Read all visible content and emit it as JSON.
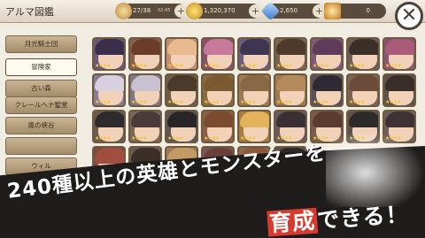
{
  "header": {
    "title": "アルマ図鑑",
    "stamina": "27/38",
    "stamina_timer": "02:45",
    "gold": "1,320,370",
    "gems": "2,650",
    "crowns": "0"
  },
  "sidebar": {
    "tabs": [
      {
        "label": "月光騎士団"
      },
      {
        "label": "冒険家"
      },
      {
        "label": "古い森"
      },
      {
        "label": "クレールヘナ聖堂"
      },
      {
        "label": "風の峡谷"
      },
      {
        "label": ""
      },
      {
        "label": "ウィル"
      },
      {
        "label": ""
      }
    ]
  },
  "grid": {
    "cards": [
      {
        "hair": "#3a2e4d",
        "bg": "#6b5776"
      },
      {
        "hair": "#6b3c2a",
        "bg": "#86624b"
      },
      {
        "hair": "#e9b98e",
        "bg": "#c58e6e"
      },
      {
        "hair": "#c7799c",
        "bg": "#8a4f6b"
      },
      {
        "hair": "#3d3552",
        "bg": "#6a5e7d"
      },
      {
        "hair": "#4d3a2c",
        "bg": "#7c6350"
      },
      {
        "hair": "#5e3b59",
        "bg": "#7f5b7a"
      },
      {
        "hair": "#3b2f2a",
        "bg": "#6e5f52"
      },
      {
        "hair": "#a85c7a",
        "bg": "#8c5570"
      },
      {
        "hair": "#d8d0e0",
        "bg": "#8a7c94"
      },
      {
        "hair": "#c9c0d1",
        "bg": "#7f7784"
      },
      {
        "hair": "#4a3a2b",
        "bg": "#6b5c49"
      },
      {
        "hair": "#7c5a2f",
        "bg": "#8a6b3f"
      },
      {
        "hair": "#8a6845",
        "bg": "#9a7b55"
      },
      {
        "hair": "#b58a5a",
        "bg": "#a07a4e"
      },
      {
        "hair": "#2e2a33",
        "bg": "#5a4f5e"
      },
      {
        "hair": "#6b4c3b",
        "bg": "#7e6350"
      },
      {
        "hair": "#3a2e2a",
        "bg": "#5e5149"
      },
      {
        "hair": "#2f2a2c",
        "bg": "#6c5b4a"
      },
      {
        "hair": "#4a3b3a",
        "bg": "#7b6555"
      },
      {
        "hair": "#2a2526",
        "bg": "#5e5451"
      },
      {
        "hair": "#7d4c2e",
        "bg": "#8b6044"
      },
      {
        "hair": "#e4b25a",
        "bg": "#a57d3f"
      },
      {
        "hair": "#3a2f33",
        "bg": "#6a585c"
      },
      {
        "hair": "#5b3b2f",
        "bg": "#7b5a4a"
      },
      {
        "hair": "#2d2a2a",
        "bg": "#5b524e"
      },
      {
        "hair": "#3e3234",
        "bg": "#6e5e5a"
      },
      {
        "hair": "#a24e3e",
        "bg": "#7c4d3f"
      },
      {
        "hair": "#3c2f2a",
        "bg": "#6b5b4c"
      },
      {
        "hair": "#c39a63",
        "bg": "#9a7b55"
      },
      {
        "hair": "#6a3e3a",
        "bg": "#7a5550"
      },
      {
        "hair": "#8c5a3a",
        "bg": "#8a6a50"
      },
      {
        "hair": "#2a2828",
        "bg": "#594e48"
      }
    ],
    "stars": "★★★★"
  },
  "banner": {
    "line1": "240種以上の英雄とモンスターを",
    "line2_hl": "育成",
    "line2_rest": "できる！"
  }
}
